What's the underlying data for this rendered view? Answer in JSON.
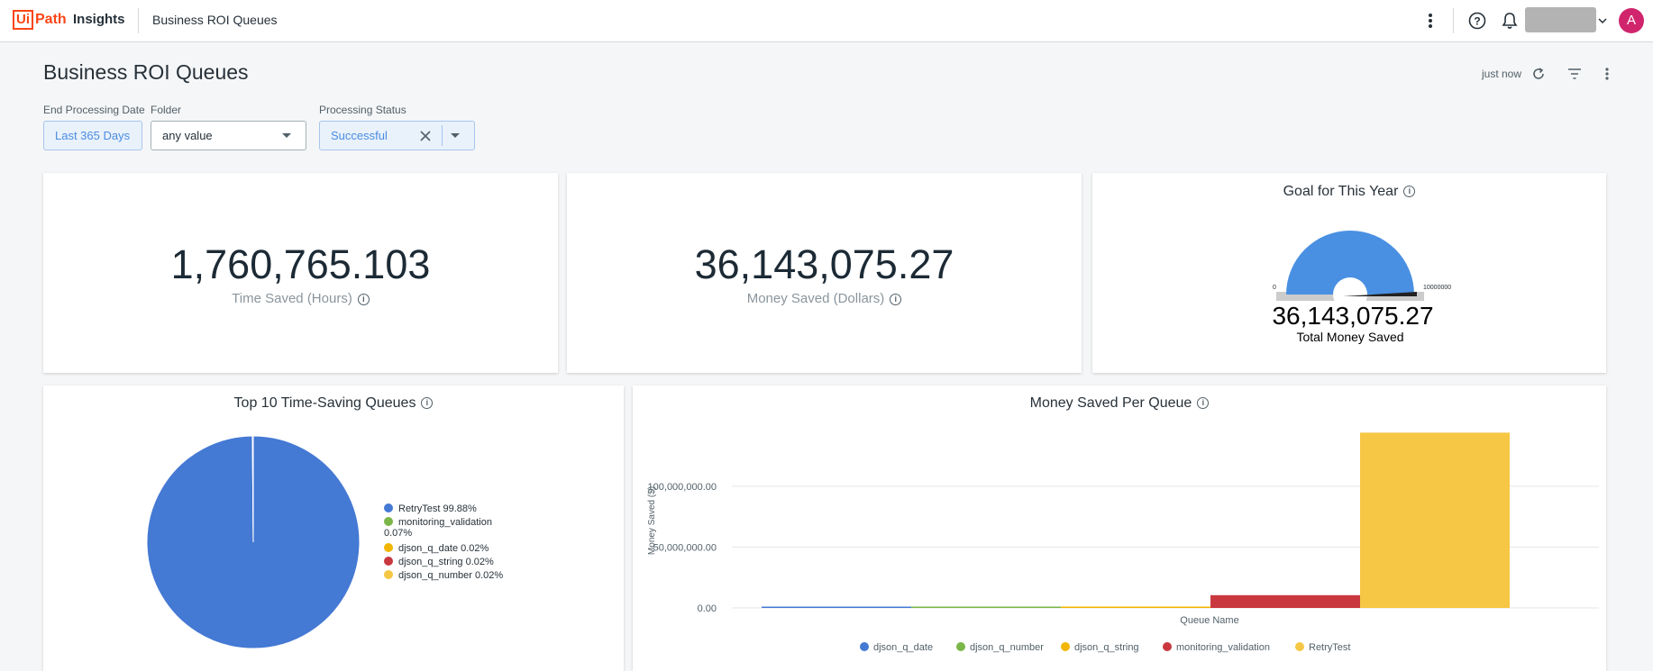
{
  "app": {
    "logo_box": "Ui",
    "logo_path": "Path",
    "product": "Insights",
    "breadcrumb": "Business ROI Queues",
    "avatar_initial": "A"
  },
  "page": {
    "title": "Business ROI Queues",
    "refresh_status": "just now"
  },
  "filters": {
    "end_date": {
      "label": "End Processing Date",
      "value": "Last 365 Days"
    },
    "folder": {
      "label": "Folder",
      "value": "any value"
    },
    "status": {
      "label": "Processing Status",
      "value": "Successful"
    }
  },
  "kpis": {
    "time_saved": {
      "value": "1,760,765.103",
      "label": "Time Saved (Hours)"
    },
    "money_saved": {
      "value": "36,143,075.27",
      "label": "Money Saved (Dollars)"
    }
  },
  "goal": {
    "title": "Goal for This Year",
    "min_label": "0",
    "max_label": "10000000",
    "value_text": "36,143,075.27",
    "caption": "Total Money Saved",
    "gauge_fraction": 1.0,
    "fill_color": "#4a90e2"
  },
  "pie": {
    "title": "Top 10 Time-Saving Queues",
    "slices": [
      {
        "name": "RetryTest",
        "pct": 99.88,
        "label": "RetryTest 99.88%",
        "color": "#4479d4"
      },
      {
        "name": "monitoring_validation",
        "pct": 0.07,
        "label": "monitoring_validation 0.07%",
        "color": "#7ab648"
      },
      {
        "name": "djson_q_date",
        "pct": 0.02,
        "label": "djson_q_date 0.02%",
        "color": "#f2b600"
      },
      {
        "name": "djson_q_string",
        "pct": 0.02,
        "label": "djson_q_string 0.02%",
        "color": "#c9383f"
      },
      {
        "name": "djson_q_number",
        "pct": 0.02,
        "label": "djson_q_number 0.02%",
        "color": "#f6c744"
      }
    ]
  },
  "chart_data": {
    "type": "bar",
    "title": "Money Saved Per Queue",
    "xlabel": "Queue Name",
    "ylabel": "Money Saved ($)",
    "ylim": [
      0,
      145000000
    ],
    "yticks": [
      0,
      50000000,
      100000000
    ],
    "ytick_labels": [
      "0.00",
      "50,000,000.00",
      "100,000,000.00"
    ],
    "grid": true,
    "legend_position": "bottom",
    "categories": [
      "djson_q_date",
      "djson_q_number",
      "djson_q_string",
      "monitoring_validation",
      "RetryTest"
    ],
    "values": [
      1000000,
      1000000,
      1000000,
      10500000,
      144000000
    ],
    "colors": [
      "#4479d4",
      "#7ab648",
      "#f2b600",
      "#c9383f",
      "#f6c744"
    ]
  }
}
